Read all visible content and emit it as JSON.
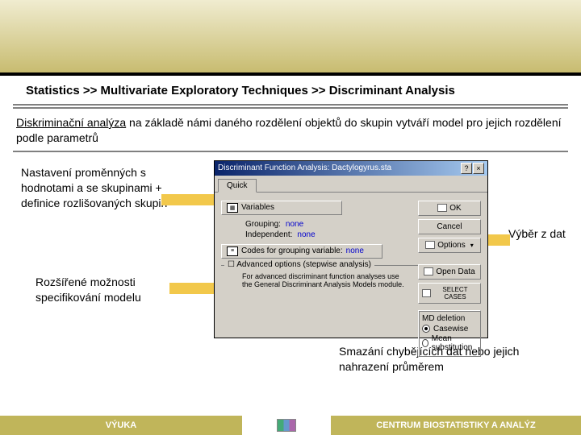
{
  "breadcrumb": "Statistics >> Multivariate Exploratory Techniques >> Discriminant Analysis",
  "description_underline": "Diskriminační analýza",
  "description_rest": " na základě námi daného rozdělení objektů do skupin vytváří model pro jejich rozdělení podle parametrů",
  "notes": {
    "vars": "Nastavení proměnných s hodnotami a se skupinami + definice rozlišovaných skupin",
    "advanced": "Rozšířené možnosti specifikování modelu",
    "data_select": "Výběr z dat",
    "deletion": "Smazání chybějících dat nebo jejich nahrazení průměrem"
  },
  "dialog": {
    "title": "Discriminant Function Analysis: Dactylogyrus.sta",
    "tab": "Quick",
    "variables_btn": "Variables",
    "grouping_label": "Grouping:",
    "grouping_val": "none",
    "independent_label": "Independent:",
    "independent_val": "none",
    "codes_btn": "Codes for grouping variable:",
    "codes_val": "none",
    "adv_label": "Advanced options (stepwise analysis)",
    "adv_text": "For advanced discriminant function analyses use the General Discriminant Analysis Models module.",
    "ok": "OK",
    "cancel": "Cancel",
    "options": "Options",
    "open": "Open Data",
    "select": "SELECT CASES",
    "md_label": "MD deletion",
    "md_casewise": "Casewise",
    "md_mean": "Mean substitution"
  },
  "footer": {
    "left": "VÝUKA",
    "right": "CENTRUM BIOSTATISTIKY A ANALÝZ"
  }
}
